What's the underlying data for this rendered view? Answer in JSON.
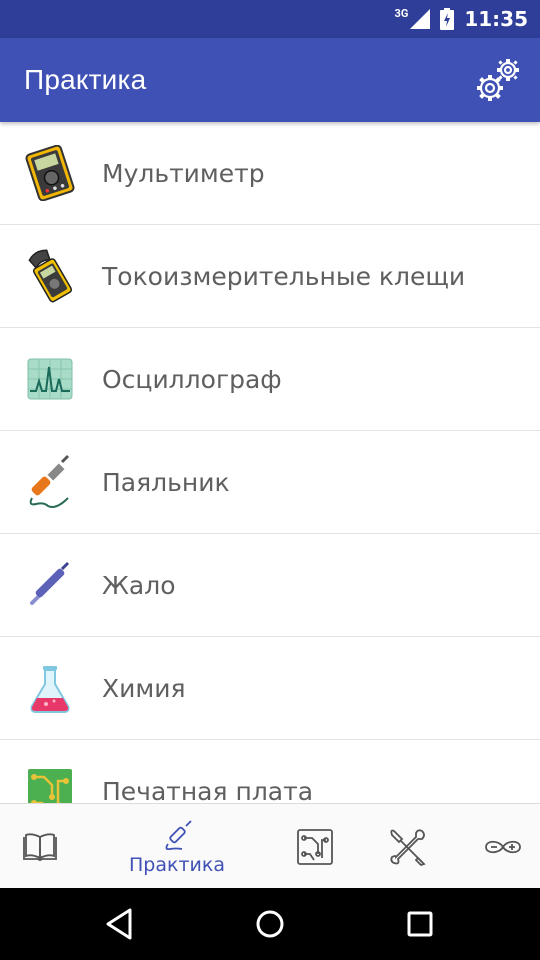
{
  "status_bar": {
    "network": "3G",
    "time": "11:35"
  },
  "app_bar": {
    "title": "Практика",
    "settings_icon": "gears-icon"
  },
  "list": {
    "items": [
      {
        "label": "Мультиметр",
        "icon": "multimeter-icon"
      },
      {
        "label": "Токоизмерительные клещи",
        "icon": "clamp-meter-icon"
      },
      {
        "label": "Осциллограф",
        "icon": "oscilloscope-icon"
      },
      {
        "label": "Паяльник",
        "icon": "soldering-iron-icon"
      },
      {
        "label": "Жало",
        "icon": "soldering-tip-icon"
      },
      {
        "label": "Химия",
        "icon": "flask-icon"
      },
      {
        "label": "Печатная плата",
        "icon": "pcb-icon"
      }
    ]
  },
  "bottom_nav": {
    "items": [
      {
        "icon": "book-icon",
        "label": ""
      },
      {
        "icon": "soldering-iron-outline-icon",
        "label": "Практика",
        "active": true
      },
      {
        "icon": "circuit-board-icon",
        "label": ""
      },
      {
        "icon": "tools-icon",
        "label": ""
      },
      {
        "icon": "arduino-icon",
        "label": ""
      }
    ]
  },
  "colors": {
    "status_bar": "#2f3e98",
    "app_bar": "#3f51b5",
    "accent": "#3f51b5",
    "list_text": "#5f5f5f"
  },
  "system_nav": {
    "back_icon": "back-triangle-icon",
    "home_icon": "home-circle-icon",
    "recents_icon": "recents-square-icon"
  }
}
